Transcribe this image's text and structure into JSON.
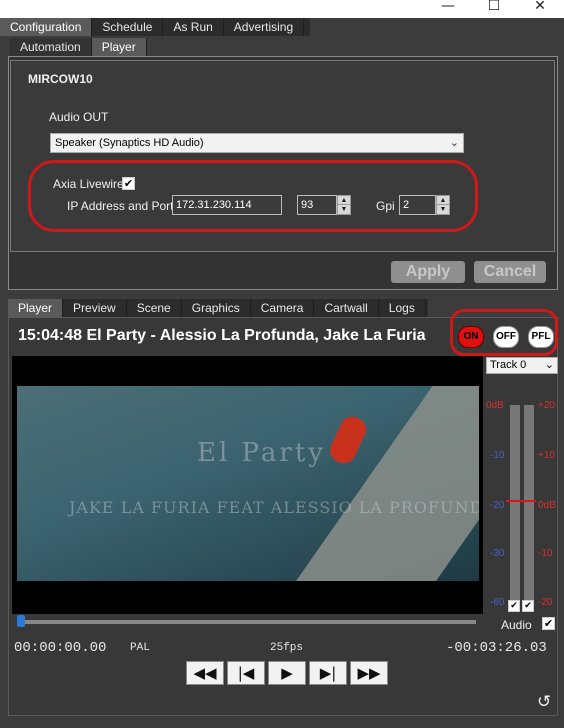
{
  "window": {
    "minimize_icon": "—",
    "maximize_icon": "☐",
    "close_icon": "✕"
  },
  "top_tabs": [
    "Configuration",
    "Schedule",
    "As Run",
    "Advertising"
  ],
  "sub_tabs": [
    "Automation",
    "Player"
  ],
  "config": {
    "section_title": "MIRCOW10",
    "audio_out_label": "Audio OUT",
    "audio_out_value": "Speaker (Synaptics HD Audio)",
    "axia_label": "Axia Livewire",
    "axia_checked": "✔",
    "ip_label": "IP Address and Port",
    "ip_value": "172.31.230.114",
    "port_value": "93",
    "gpi_label": "Gpi",
    "gpi_value": "2",
    "apply_label": "Apply",
    "cancel_label": "Cancel"
  },
  "player_tabs": [
    "Player",
    "Preview",
    "Scene",
    "Graphics",
    "Camera",
    "Cartwall",
    "Logs"
  ],
  "player": {
    "now_playing": "15:04:48 El Party - Alessio La Profunda, Jake La Furia",
    "on_label": "ON",
    "off_label": "OFF",
    "pfl_label": "PFL",
    "video_title": "El Party",
    "video_subtitle": "JAKE LA FURIA FEAT ALESSIO LA PROFUNDA MELODIA",
    "track_select": "Track 0",
    "meter_left_labels": [
      "0dB",
      "-10",
      "-20",
      "-30",
      "-60"
    ],
    "meter_right_labels": [
      "+20",
      "+10",
      "0dB",
      "-10",
      "-20"
    ],
    "audio_label": "Audio",
    "audio_checked": "✔",
    "elapsed": "00:00:00.00",
    "format": "PAL",
    "fps": "25fps",
    "remaining": "-00:03:26.03",
    "controls": {
      "rewind": "◀◀",
      "prev": "|◀",
      "play": "▶",
      "next": "▶|",
      "forward": "▶▶"
    },
    "history_icon": "↺",
    "seek_position": 0.0
  },
  "colors": {
    "on_red": "#e01010",
    "highlight_oval": "#d01818",
    "meter_marker": "#d81818"
  }
}
